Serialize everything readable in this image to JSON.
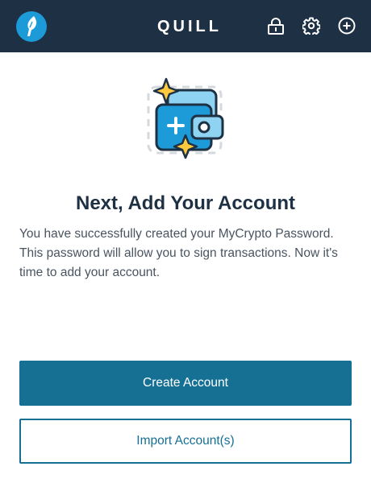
{
  "header": {
    "brand": "QUILL",
    "logo_icon": "mycrypto-quill-logo-icon",
    "actions": [
      {
        "name": "lock",
        "icon": "lock-icon"
      },
      {
        "name": "settings",
        "icon": "gear-icon"
      },
      {
        "name": "add",
        "icon": "plus-circle-icon"
      }
    ],
    "background_color": "#1e3043"
  },
  "main": {
    "illustration_icon": "wallet-add-sparkle-icon",
    "heading": "Next, Add Your Account",
    "description": "You have successfully created your MyCrypto Password. This password will allow you to sign transactions. Now it's time to add your account.",
    "create_button_label": "Create Account",
    "import_button_label": "Import Account(s)"
  },
  "colors": {
    "primary": "#167094",
    "heading": "#1e3043",
    "body_text": "#4a5461",
    "illustration_blue": "#1c9bd8",
    "sparkle": "#ffc83d"
  }
}
